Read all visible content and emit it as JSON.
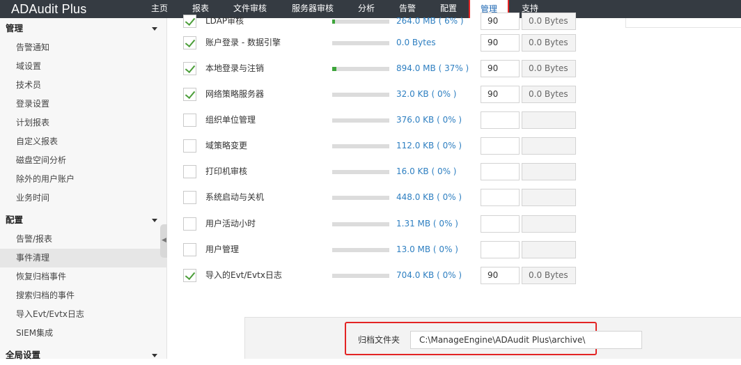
{
  "app": {
    "title": "ADAudit Plus"
  },
  "nav": [
    {
      "label": "主页"
    },
    {
      "label": "报表"
    },
    {
      "label": "文件审核"
    },
    {
      "label": "服务器审核"
    },
    {
      "label": "分析"
    },
    {
      "label": "告警"
    },
    {
      "label": "配置"
    },
    {
      "label": "管理",
      "active": true
    },
    {
      "label": "支持"
    }
  ],
  "sidebar": {
    "sections": [
      {
        "title": "管理",
        "items": [
          "告警通知",
          "域设置",
          "技术员",
          "登录设置",
          "计划报表",
          "自定义报表",
          "磁盘空间分析",
          "除外的用户账户",
          "业务时间"
        ]
      },
      {
        "title": "配置",
        "items": [
          "告警/报表",
          "事件清理",
          "恢复归档事件",
          "搜索归档的事件",
          "导入Evt/Evtx日志",
          "SIEM集成"
        ],
        "active_item": "事件清理"
      },
      {
        "title": "全局设置",
        "items": []
      }
    ]
  },
  "event_rows": [
    {
      "label": "LDAP审核",
      "checked": true,
      "size": "264.0 MB ( 6% )",
      "percent": 6,
      "days": "90",
      "archived": "0.0 Bytes"
    },
    {
      "label": "账户登录 - 数据引擎",
      "checked": true,
      "size": "0.0 Bytes",
      "percent": 0,
      "days": "90",
      "archived": "0.0 Bytes"
    },
    {
      "label": "本地登录与注销",
      "checked": true,
      "size": "894.0 MB ( 37% )",
      "percent": 37,
      "days": "90",
      "archived": "0.0 Bytes"
    },
    {
      "label": "网络策略服务器",
      "checked": true,
      "size": "32.0 KB ( 0% )",
      "percent": 0,
      "days": "90",
      "archived": "0.0 Bytes"
    },
    {
      "label": "组织单位管理",
      "checked": false,
      "size": "376.0 KB ( 0% )",
      "percent": 0,
      "days": "",
      "archived": ""
    },
    {
      "label": "域策略变更",
      "checked": false,
      "size": "112.0 KB ( 0% )",
      "percent": 0,
      "days": "",
      "archived": ""
    },
    {
      "label": "打印机审核",
      "checked": false,
      "size": "16.0 KB ( 0% )",
      "percent": 0,
      "days": "",
      "archived": ""
    },
    {
      "label": "系统启动与关机",
      "checked": false,
      "size": "448.0 KB ( 0% )",
      "percent": 0,
      "days": "",
      "archived": ""
    },
    {
      "label": "用户活动小时",
      "checked": false,
      "size": "1.31 MB ( 0% )",
      "percent": 0,
      "days": "",
      "archived": ""
    },
    {
      "label": "用户管理",
      "checked": false,
      "size": "13.0 MB ( 0% )",
      "percent": 0,
      "days": "",
      "archived": ""
    },
    {
      "label": "导入的Evt/Evtx日志",
      "checked": true,
      "size": "704.0 KB ( 0% )",
      "percent": 0,
      "days": "90",
      "archived": "0.0 Bytes"
    }
  ],
  "archive": {
    "label": "归档文件夹",
    "path": "C:\\ManageEngine\\ADAudit Plus\\archive\\"
  },
  "colors": {
    "topbar": "#353b42",
    "link_blue": "#2e7fc1",
    "progress_green": "#3da53b",
    "highlight_red": "#e32424"
  }
}
